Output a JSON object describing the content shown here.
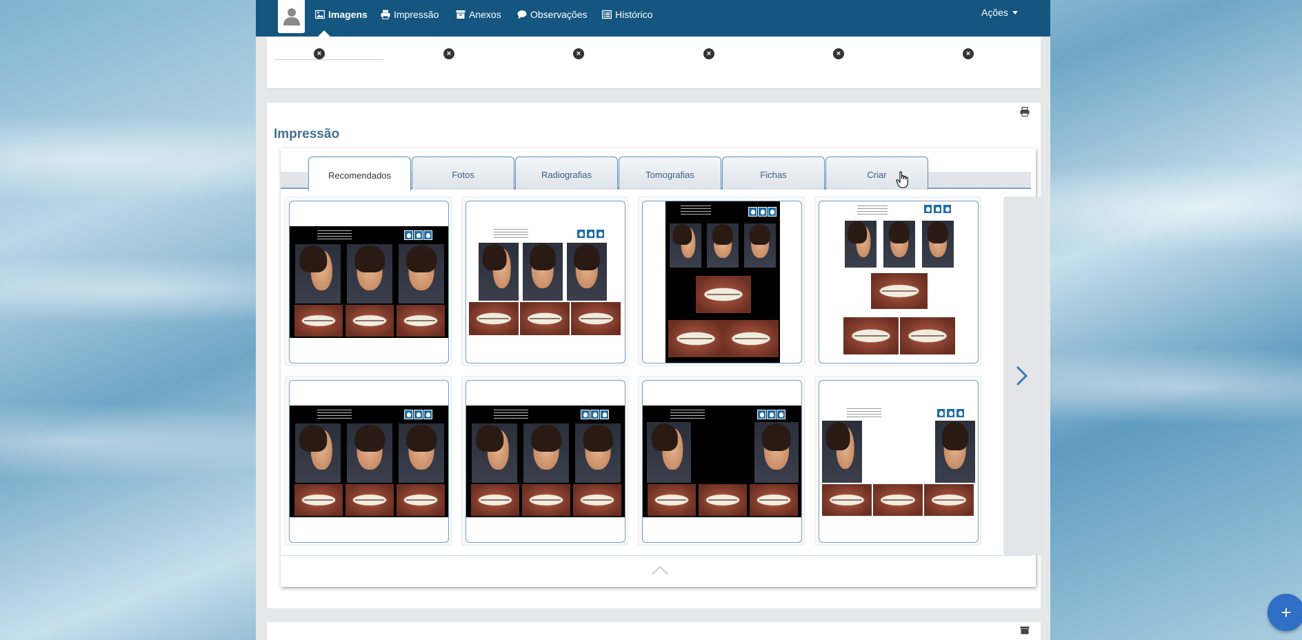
{
  "nav": {
    "items": [
      {
        "label": "Imagens",
        "icon": "image-icon",
        "active": true
      },
      {
        "label": "Impressão",
        "icon": "printer-icon",
        "active": false
      },
      {
        "label": "Anexos",
        "icon": "archive-icon",
        "active": false
      },
      {
        "label": "Observações",
        "icon": "comment-icon",
        "active": false
      },
      {
        "label": "Histórico",
        "icon": "list-icon",
        "active": false
      }
    ],
    "actions_label": "Ações"
  },
  "image_strip": {
    "remove_glyph": "×",
    "count": 6
  },
  "impressao": {
    "title": "Impressão",
    "tabs": [
      {
        "label": "Recomendados",
        "active": true
      },
      {
        "label": "Fotos",
        "active": false
      },
      {
        "label": "Radiografias",
        "active": false
      },
      {
        "label": "Tomografias",
        "active": false
      },
      {
        "label": "Fichas",
        "active": false
      },
      {
        "label": "Criar",
        "active": false
      }
    ],
    "templates": [
      {
        "name": "template-1",
        "style": "dark-landscape-3x2"
      },
      {
        "name": "template-2",
        "style": "light-landscape-3x2"
      },
      {
        "name": "template-3",
        "style": "dark-portrait"
      },
      {
        "name": "template-4",
        "style": "light-portrait"
      },
      {
        "name": "template-5",
        "style": "dark-landscape-3x2"
      },
      {
        "name": "template-6",
        "style": "dark-landscape-3x2"
      },
      {
        "name": "template-7",
        "style": "dark-landscape-2x3"
      },
      {
        "name": "template-8",
        "style": "light-landscape-2x3"
      }
    ]
  },
  "fab": {
    "label": "+"
  },
  "colors": {
    "navbar": "#14567f",
    "title": "#3f6f95",
    "tab_border": "#5a8fba",
    "fab": "#2f6fc6"
  }
}
